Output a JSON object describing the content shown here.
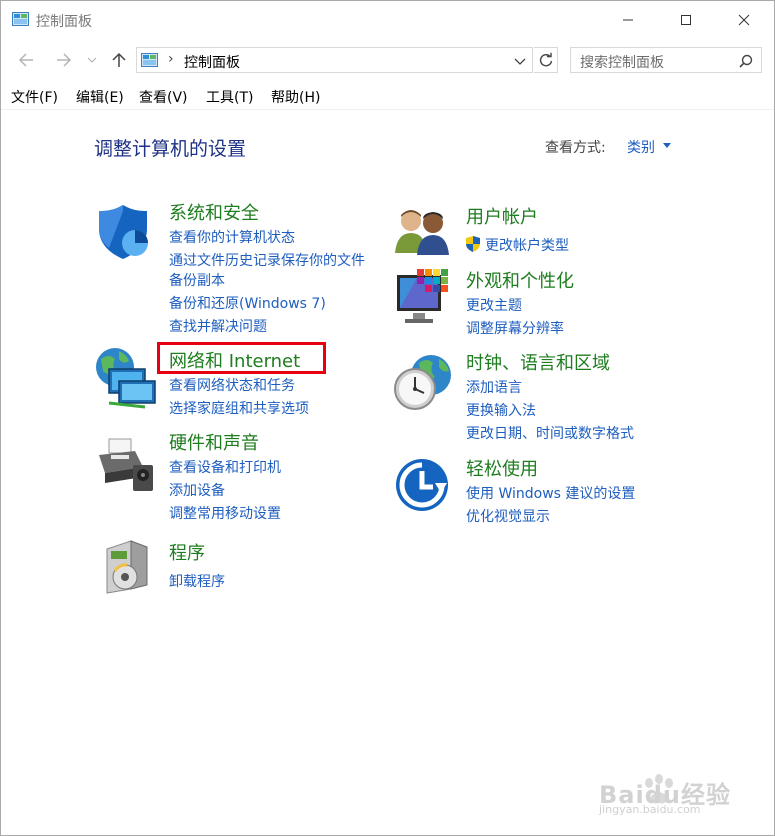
{
  "window": {
    "title": "控制面板"
  },
  "address": {
    "path": "控制面板",
    "separator": "›"
  },
  "search": {
    "placeholder": "搜索控制面板"
  },
  "menu": [
    "文件(F)",
    "编辑(E)",
    "查看(V)",
    "工具(T)",
    "帮助(H)"
  ],
  "content": {
    "heading": "调整计算机的设置",
    "view_by_label": "查看方式:",
    "view_by_value": "类别"
  },
  "categories": {
    "system_security": {
      "title": "系统和安全",
      "links": [
        "查看你的计算机状态",
        "通过文件历史记录保存你的文件",
        "备份副本",
        "备份和还原(Windows 7)",
        "查找并解决问题"
      ]
    },
    "network": {
      "title": "网络和 Internet",
      "links": [
        "查看网络状态和任务",
        "选择家庭组和共享选项"
      ]
    },
    "hardware": {
      "title": "硬件和声音",
      "links": [
        "查看设备和打印机",
        "添加设备",
        "调整常用移动设置"
      ]
    },
    "programs": {
      "title": "程序",
      "links": [
        "卸载程序"
      ]
    },
    "user_accounts": {
      "title": "用户帐户",
      "links": [
        "更改帐户类型"
      ]
    },
    "appearance": {
      "title": "外观和个性化",
      "links": [
        "更改主题",
        "调整屏幕分辨率"
      ]
    },
    "clock": {
      "title": "时钟、语言和区域",
      "links": [
        "添加语言",
        "更换输入法",
        "更改日期、时间或数字格式"
      ]
    },
    "ease": {
      "title": "轻松使用",
      "links": [
        "使用 Windows 建议的设置",
        "优化视觉显示"
      ]
    }
  },
  "watermark": {
    "text": "Baidu经验",
    "sub": "jingyan.baidu.com"
  },
  "colors": {
    "heading": "#1e3287",
    "category": "#1e7d1e",
    "link": "#1e5ebf",
    "highlight": "#e60012"
  }
}
